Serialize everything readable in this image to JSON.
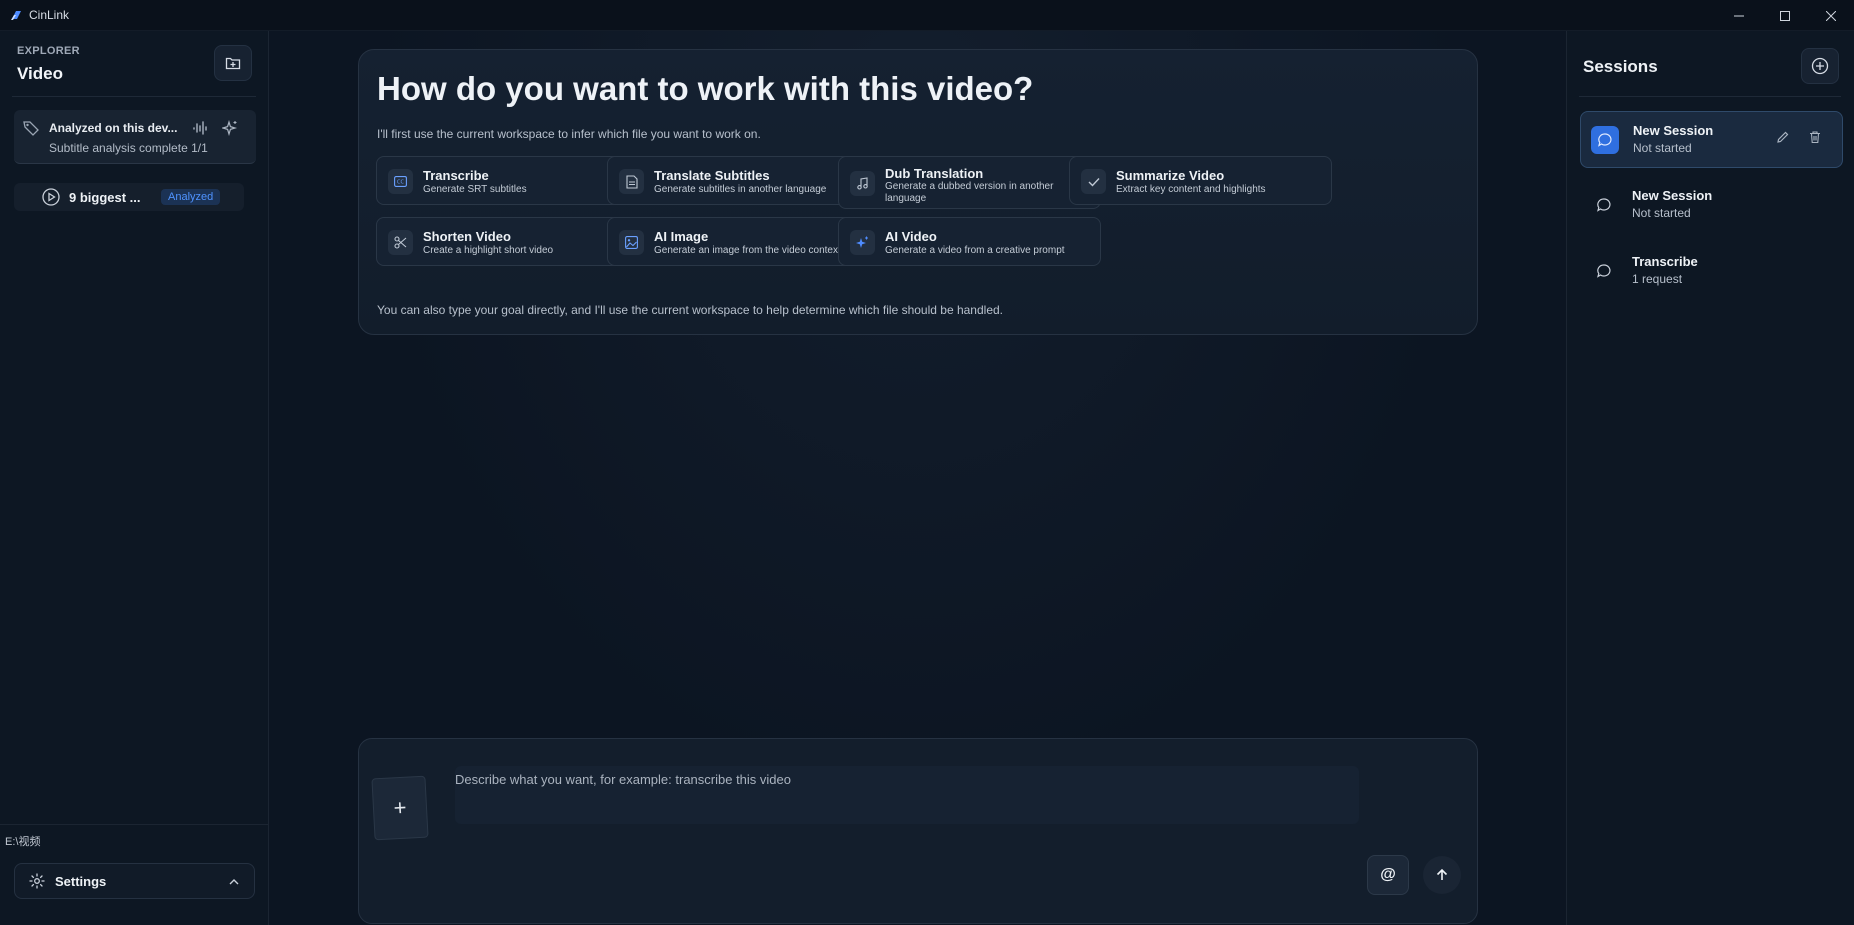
{
  "window": {
    "title": "CinLink",
    "controls": [
      "minimize",
      "maximize",
      "close"
    ]
  },
  "explorer": {
    "label": "EXPLORER",
    "title": "Video",
    "analysis": {
      "title": "Analyzed on this dev...",
      "status": "Subtitle analysis complete 1/1"
    },
    "files": [
      {
        "name": "9 biggest ...",
        "badge": "Analyzed"
      }
    ],
    "path": "E:\\视频",
    "settings_label": "Settings"
  },
  "main": {
    "heading": "How do you want to work with this video?",
    "intro": "I'll first use the current workspace to infer which file you want to work on.",
    "options": [
      {
        "title": "Transcribe",
        "desc": "Generate SRT subtitles",
        "icon": "cc-icon"
      },
      {
        "title": "Translate Subtitles",
        "desc": "Generate subtitles in another language",
        "icon": "document-icon"
      },
      {
        "title": "Dub Translation",
        "desc": "Generate a dubbed version in another language",
        "icon": "music-note-icon"
      },
      {
        "title": "Summarize Video",
        "desc": "Extract key content and highlights",
        "icon": "check-icon"
      },
      {
        "title": "Shorten Video",
        "desc": "Create a highlight short video",
        "icon": "scissors-icon"
      },
      {
        "title": "AI Image",
        "desc": "Generate an image from the video context",
        "icon": "image-icon"
      },
      {
        "title": "AI Video",
        "desc": "Generate a video from a creative prompt",
        "icon": "sparkle-icon"
      }
    ],
    "footer_note": "You can also type your goal directly, and I'll use the current workspace to help determine which file should be handled.",
    "composer": {
      "placeholder": "Describe what you want, for example: transcribe this video",
      "attach_label": "+",
      "mention_label": "@"
    }
  },
  "sessions": {
    "title": "Sessions",
    "items": [
      {
        "title": "New Session",
        "subtitle": "Not started",
        "active": true
      },
      {
        "title": "New Session",
        "subtitle": "Not started",
        "active": false
      },
      {
        "title": "Transcribe",
        "subtitle": "1 request",
        "active": false
      }
    ]
  },
  "colors": {
    "accent": "#2f6fe0",
    "badge_text": "#4f93ff",
    "background": "#0c1522"
  }
}
